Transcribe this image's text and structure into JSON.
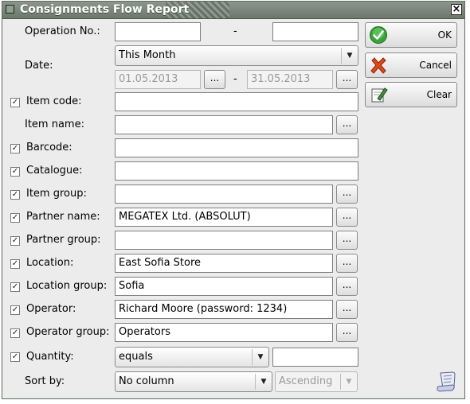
{
  "window": {
    "title": "Consignments Flow Report",
    "close_glyph": "×"
  },
  "buttons": {
    "ok": "OK",
    "cancel": "Cancel",
    "clear": "Clear"
  },
  "browse_label": "...",
  "operation": {
    "label": "Operation No.:",
    "from": "",
    "to": "",
    "dash": "-"
  },
  "date": {
    "label": "Date:",
    "period": "This Month",
    "from": "01.05.2013",
    "to": "31.05.2013",
    "dash": "-"
  },
  "rows": [
    {
      "key": "item_code",
      "label": "Item code:",
      "checked": true,
      "value": "",
      "browse": false
    },
    {
      "key": "item_name",
      "label": "Item name:",
      "checked": false,
      "value": "",
      "browse": true
    },
    {
      "key": "barcode",
      "label": "Barcode:",
      "checked": true,
      "value": "",
      "browse": false
    },
    {
      "key": "catalogue",
      "label": "Catalogue:",
      "checked": true,
      "value": "",
      "browse": false
    },
    {
      "key": "item_group",
      "label": "Item group:",
      "checked": true,
      "value": "",
      "browse": true
    },
    {
      "key": "partner_name",
      "label": "Partner name:",
      "checked": true,
      "value": "MEGATEX Ltd. (ABSOLUT)",
      "browse": true
    },
    {
      "key": "partner_group",
      "label": "Partner group:",
      "checked": true,
      "value": "",
      "browse": true
    },
    {
      "key": "location",
      "label": "Location:",
      "checked": true,
      "value": "East Sofia Store",
      "browse": true
    },
    {
      "key": "location_group",
      "label": "Location group:",
      "checked": true,
      "value": "Sofia",
      "browse": true
    },
    {
      "key": "operator",
      "label": "Operator:",
      "checked": true,
      "value": "Richard Moore (password: 1234)",
      "browse": true
    },
    {
      "key": "operator_group",
      "label": "Operator group:",
      "checked": true,
      "value": "Operators",
      "browse": true
    }
  ],
  "quantity": {
    "label": "Quantity:",
    "checked": true,
    "condition": "equals",
    "value": ""
  },
  "sort": {
    "label": "Sort by:",
    "column": "No column",
    "order": "Ascending"
  },
  "colors": {
    "titlebar": "#7b887b",
    "ok_icon": "#3ca23c",
    "cancel_icon": "#e04a1a",
    "window_bg": "#ececec"
  },
  "icons": {
    "ok": "check-circle-icon",
    "cancel": "red-x-icon",
    "clear": "eraser-note-icon",
    "corner": "scroll-paper-icon",
    "dropdown": "triangle-down-icon",
    "checkbox": "checkmark"
  }
}
